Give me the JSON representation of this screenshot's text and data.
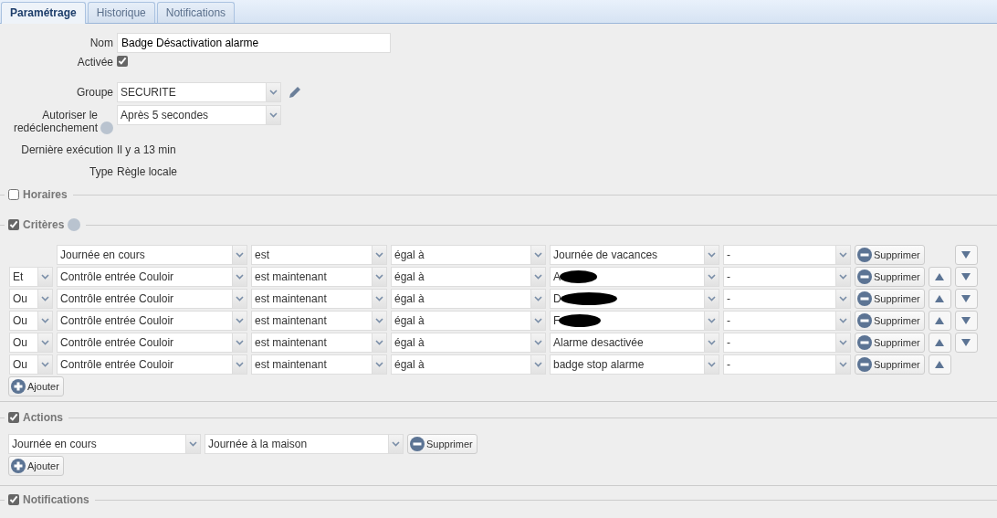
{
  "tabs": [
    {
      "label": "Paramétrage",
      "selected": true
    },
    {
      "label": "Historique",
      "selected": false
    },
    {
      "label": "Notifications",
      "selected": false
    }
  ],
  "form": [
    {
      "kind": "text",
      "label": "Nom",
      "value": "Badge Désactivation alarme"
    },
    {
      "kind": "checkbox",
      "label": "Activée",
      "checked": true
    },
    {
      "kind": "select",
      "label": "Groupe",
      "value": "SECURITE",
      "editable": true
    },
    {
      "kind": "select",
      "label": "Autoriser le redéclenchement",
      "value": "Après 5 secondes",
      "help": true
    },
    {
      "kind": "static",
      "label": "Dernière exécution",
      "value": "Il y a 13 min"
    },
    {
      "kind": "static",
      "label": "Type",
      "value": "Règle locale"
    }
  ],
  "sections": [
    {
      "kind": "schedule",
      "title": "Horaires",
      "checked": false
    },
    {
      "kind": "criteria",
      "title": "Critères",
      "checked": true,
      "help": true,
      "add_label": "Ajouter",
      "criteria": [
        {
          "attribute": "Journée en cours",
          "operator": "est",
          "comparator": "égal à",
          "value": "Journée de vacances",
          "redacted": false,
          "extra": "-",
          "delete_label": "Supprimer",
          "move_up": false,
          "move_down": true
        },
        {
          "conjunction": "Et",
          "attribute": "Contrôle entrée Couloir",
          "operator": "est maintenant",
          "comparator": "égal à",
          "value": "A",
          "redacted": true,
          "extra": "-",
          "delete_label": "Supprimer",
          "move_up": true,
          "move_down": true
        },
        {
          "conjunction": "Ou",
          "attribute": "Contrôle entrée Couloir",
          "operator": "est maintenant",
          "comparator": "égal à",
          "value": "D",
          "redacted": true,
          "extra": "-",
          "delete_label": "Supprimer",
          "move_up": true,
          "move_down": true
        },
        {
          "conjunction": "Ou",
          "attribute": "Contrôle entrée Couloir",
          "operator": "est maintenant",
          "comparator": "égal à",
          "value": "F",
          "redacted": true,
          "extra": "-",
          "delete_label": "Supprimer",
          "move_up": true,
          "move_down": true
        },
        {
          "conjunction": "Ou",
          "attribute": "Contrôle entrée Couloir",
          "operator": "est maintenant",
          "comparator": "égal à",
          "value": "Alarme desactivée",
          "redacted": false,
          "extra": "-",
          "delete_label": "Supprimer",
          "move_up": true,
          "move_down": true
        },
        {
          "conjunction": "Ou",
          "attribute": "Contrôle entrée Couloir",
          "operator": "est maintenant",
          "comparator": "égal à",
          "value": "badge stop alarme",
          "redacted": false,
          "extra": "-",
          "delete_label": "Supprimer",
          "move_up": true,
          "move_down": false
        }
      ]
    },
    {
      "kind": "actions",
      "title": "Actions",
      "checked": true,
      "add_label": "Ajouter",
      "actions": [
        {
          "target": "Journée en cours",
          "value": "Journée à la maison",
          "delete_label": "Supprimer"
        }
      ]
    },
    {
      "kind": "notifications",
      "title": "Notifications",
      "checked": true
    }
  ]
}
